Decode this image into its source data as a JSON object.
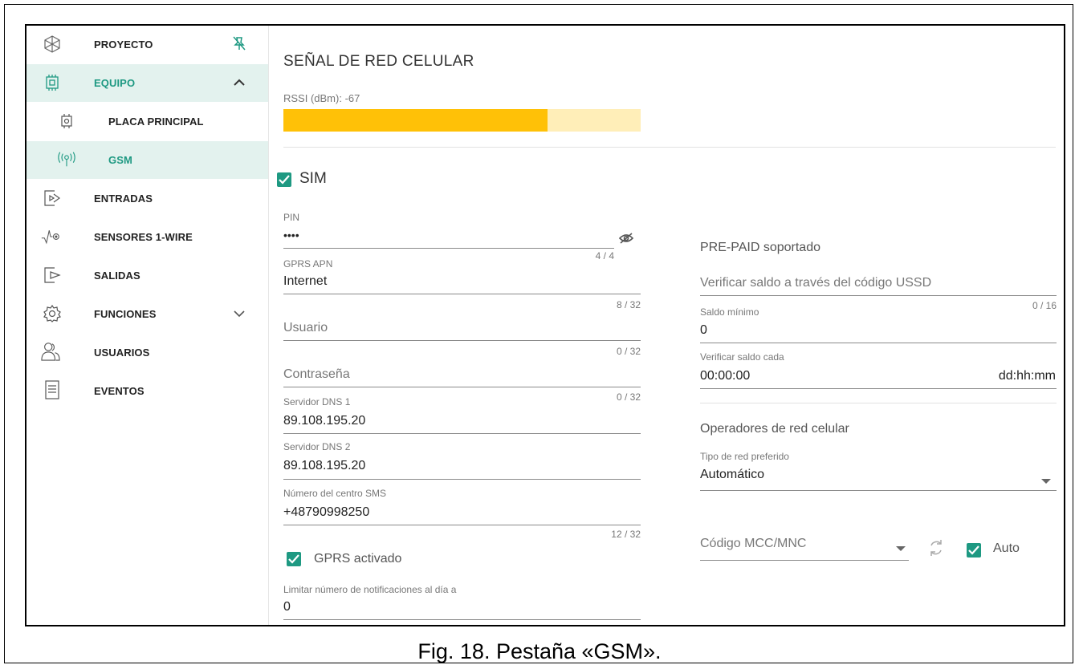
{
  "sidebar": {
    "items": [
      {
        "label": "PROYECTO"
      },
      {
        "label": "EQUIPO"
      },
      {
        "label": "PLACA PRINCIPAL"
      },
      {
        "label": "GSM"
      },
      {
        "label": "ENTRADAS"
      },
      {
        "label": "SENSORES 1-WIRE"
      },
      {
        "label": "SALIDAS"
      },
      {
        "label": "FUNCIONES"
      },
      {
        "label": "USUARIOS"
      },
      {
        "label": "EVENTOS"
      }
    ]
  },
  "signal": {
    "title": "SEÑAL DE RED CELULAR",
    "rssi_label": "RSSI (dBm): -67",
    "level_fraction": 0.74,
    "bar_color": "#ffc107",
    "bar_bg_color": "#ffeeb8"
  },
  "sim": {
    "checkbox_label": "SIM",
    "checked": true,
    "pin_label": "PIN",
    "pin_value": "••••",
    "pin_counter": "4 / 4",
    "apn_label": "GPRS APN",
    "apn_value": "Internet",
    "apn_counter": "8 / 32",
    "user_placeholder": "Usuario",
    "user_counter": "0 / 32",
    "password_placeholder": "Contraseña",
    "password_counter": "0 / 32",
    "dns1_label": "Servidor DNS 1",
    "dns1_value": "89.108.195.20",
    "dns2_label": "Servidor DNS 2",
    "dns2_value": "89.108.195.20",
    "sms_center_label": "Número del centro SMS",
    "sms_center_value": "+48790998250",
    "sms_center_counter": "12 / 32",
    "gprs_label": "GPRS activado",
    "gprs_checked": true,
    "limit_label": "Limitar número de notificaciones al día a",
    "limit_value": "0"
  },
  "prepaid": {
    "title": "PRE-PAID soportado",
    "ussd_placeholder": "Verificar saldo a través del código USSD",
    "ussd_counter": "0 / 16",
    "min_balance_label": "Saldo mínimo",
    "min_balance_value": "0",
    "check_every_label": "Verificar saldo cada",
    "check_every_value": "00:00:00",
    "check_every_suffix": "dd:hh:mm"
  },
  "operators": {
    "title": "Operadores de red celular",
    "network_type_label": "Tipo de red preferido",
    "network_type_value": "Automático",
    "mcc_placeholder": "Código MCC/MNC",
    "auto_label": "Auto",
    "auto_checked": true
  },
  "caption": "Fig. 18. Pestaña «GSM».",
  "colors": {
    "accent": "#1e9982",
    "active_bg": "#e3f2ee"
  }
}
